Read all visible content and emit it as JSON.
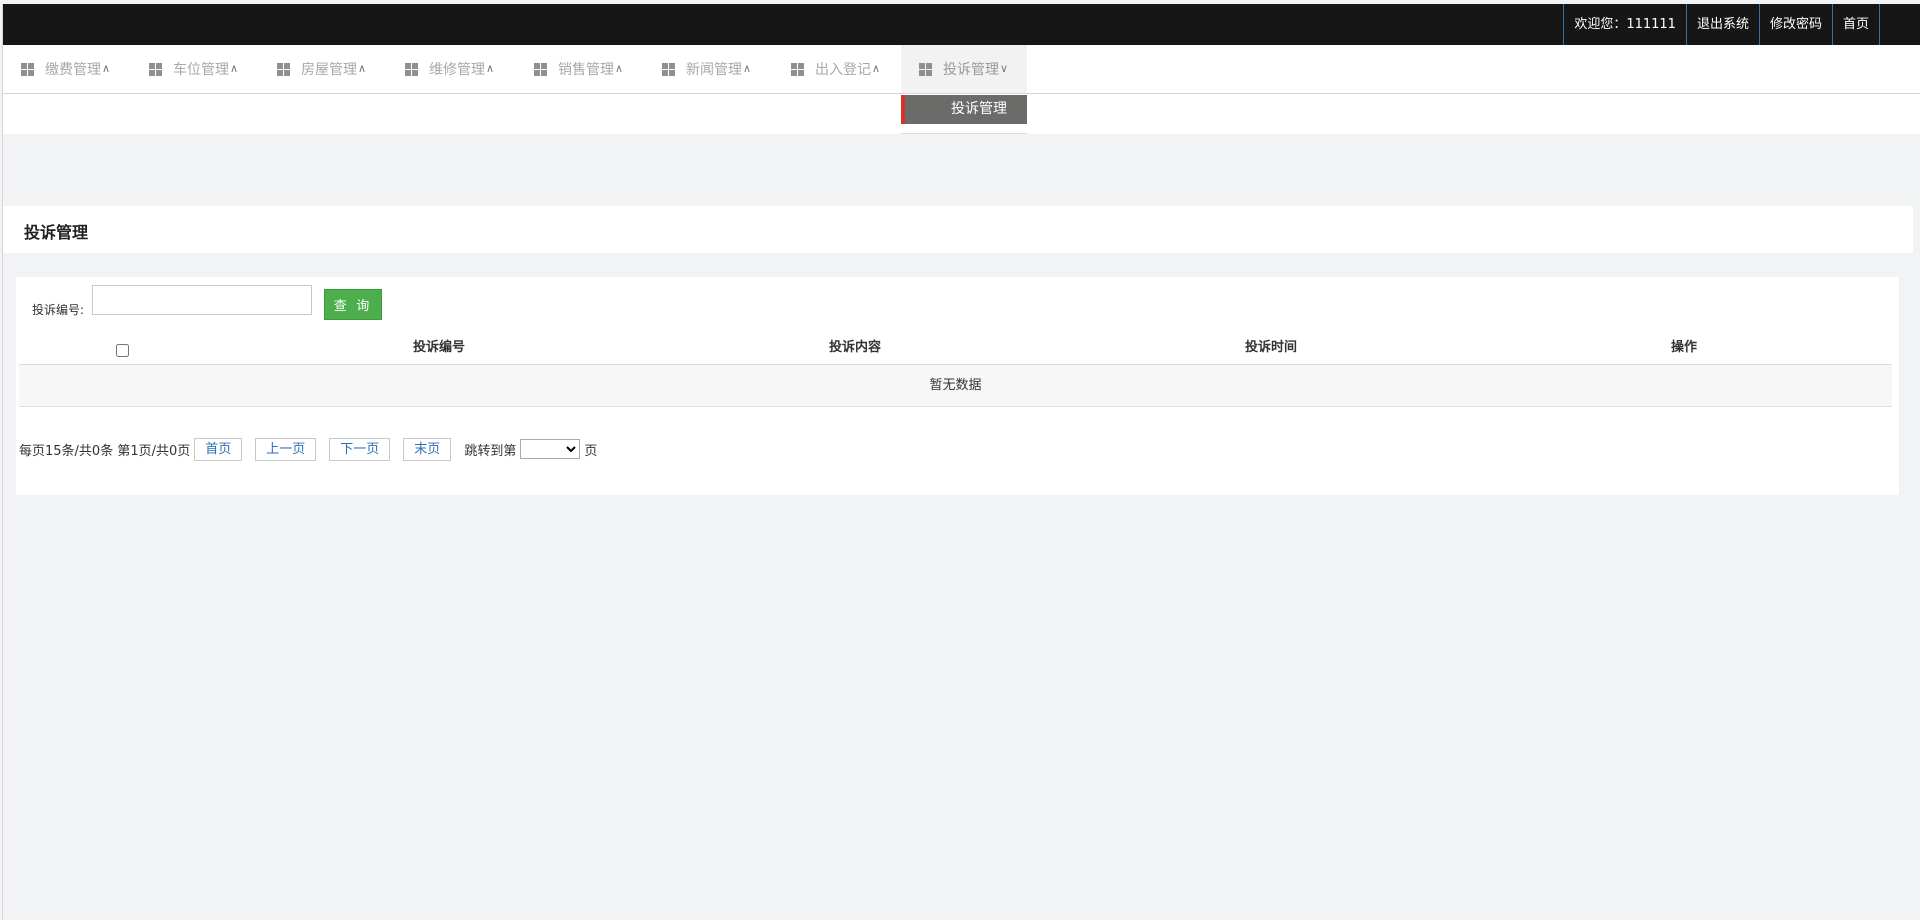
{
  "topbar": {
    "welcome": "欢迎您：111111",
    "logout": "退出系统",
    "change_password": "修改密码",
    "home": "首页"
  },
  "nav": {
    "items": [
      {
        "label": "缴费管理",
        "caret": "^"
      },
      {
        "label": "车位管理",
        "caret": "^"
      },
      {
        "label": "房屋管理",
        "caret": "^"
      },
      {
        "label": "维修管理",
        "caret": "^"
      },
      {
        "label": "销售管理",
        "caret": "^"
      },
      {
        "label": "新闻管理",
        "caret": "^"
      },
      {
        "label": "出入登记",
        "caret": "^"
      },
      {
        "label": "投诉管理",
        "caret": "v",
        "active": true
      }
    ],
    "dropdown_item": "投诉管理"
  },
  "page_title": "投诉管理",
  "search": {
    "label": "投诉编号:",
    "value": "",
    "placeholder": "",
    "button": "查 询"
  },
  "table": {
    "columns": [
      "投诉编号",
      "投诉内容",
      "投诉时间",
      "操作"
    ],
    "empty_text": "暂无数据"
  },
  "pager": {
    "summary": "每页15条/共0条 第1页/共0页",
    "first": "首页",
    "prev": "上一页",
    "next": "下一页",
    "last": "末页",
    "jump_prefix": "跳转到第",
    "jump_suffix": "页",
    "selected_page": ""
  },
  "colors": {
    "topbar": "#161616",
    "accent_red": "#d9302a",
    "query_button": "#4cae4c",
    "pager_link": "#2a6ebb"
  }
}
